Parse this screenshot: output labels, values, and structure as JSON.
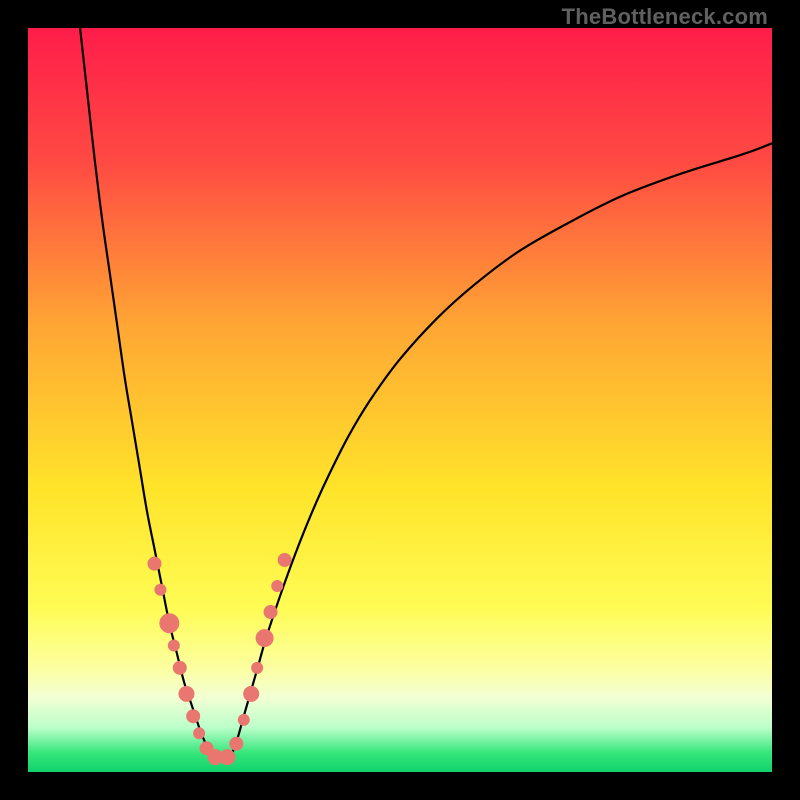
{
  "watermark": "TheBottleneck.com",
  "gradient": {
    "stops": [
      {
        "pct": 0,
        "color": "#ff1d4a"
      },
      {
        "pct": 18,
        "color": "#ff4a43"
      },
      {
        "pct": 40,
        "color": "#ffa634"
      },
      {
        "pct": 62,
        "color": "#ffe42a"
      },
      {
        "pct": 78,
        "color": "#fffc55"
      },
      {
        "pct": 86,
        "color": "#fcffa0"
      },
      {
        "pct": 90,
        "color": "#f2ffd4"
      },
      {
        "pct": 94,
        "color": "#bcffca"
      },
      {
        "pct": 97.5,
        "color": "#33e67a"
      },
      {
        "pct": 100,
        "color": "#11d26c"
      }
    ]
  },
  "chart_data": {
    "type": "line",
    "title": "",
    "xlabel": "",
    "ylabel": "",
    "xlim": [
      0,
      100
    ],
    "ylim": [
      0,
      100
    ],
    "note": "x/y are percentages of the plot area (0,0 = top-left). Two curves form a V-shaped bottleneck valley reaching the bottom near x≈25.",
    "series": [
      {
        "name": "left-curve",
        "x": [
          7,
          8,
          9,
          10,
          11,
          12,
          13,
          14,
          15,
          16,
          17,
          18,
          19,
          20,
          21,
          22,
          23,
          24,
          25
        ],
        "y": [
          0,
          9,
          18,
          26,
          33,
          40,
          47,
          53,
          59,
          65,
          70,
          75,
          80,
          84,
          88,
          91,
          94,
          96.5,
          98.5
        ]
      },
      {
        "name": "right-curve",
        "x": [
          27,
          28,
          29,
          30,
          31,
          32,
          34,
          36,
          38,
          40,
          43,
          46,
          50,
          55,
          60,
          66,
          73,
          80,
          88,
          96,
          100
        ],
        "y": [
          98.5,
          96,
          92.5,
          89,
          85.5,
          82,
          76,
          70.5,
          65.5,
          61,
          55,
          50,
          44.5,
          39,
          34.5,
          30,
          26,
          22.5,
          19.5,
          17,
          15.5
        ]
      }
    ],
    "markers": {
      "name": "scatter-points",
      "color": "#e9766f",
      "points": [
        {
          "x": 17.0,
          "y": 72.0,
          "r": 7
        },
        {
          "x": 17.8,
          "y": 75.5,
          "r": 6
        },
        {
          "x": 19.0,
          "y": 80.0,
          "r": 10
        },
        {
          "x": 19.6,
          "y": 83.0,
          "r": 6
        },
        {
          "x": 20.4,
          "y": 86.0,
          "r": 7
        },
        {
          "x": 21.3,
          "y": 89.5,
          "r": 8
        },
        {
          "x": 22.2,
          "y": 92.5,
          "r": 7
        },
        {
          "x": 23.0,
          "y": 94.8,
          "r": 6
        },
        {
          "x": 24.0,
          "y": 96.8,
          "r": 7
        },
        {
          "x": 25.2,
          "y": 98.0,
          "r": 8
        },
        {
          "x": 26.8,
          "y": 98.0,
          "r": 8
        },
        {
          "x": 28.0,
          "y": 96.2,
          "r": 7
        },
        {
          "x": 29.0,
          "y": 93.0,
          "r": 6
        },
        {
          "x": 30.0,
          "y": 89.5,
          "r": 8
        },
        {
          "x": 30.8,
          "y": 86.0,
          "r": 6
        },
        {
          "x": 31.8,
          "y": 82.0,
          "r": 9
        },
        {
          "x": 32.6,
          "y": 78.5,
          "r": 7
        },
        {
          "x": 33.5,
          "y": 75.0,
          "r": 6
        },
        {
          "x": 34.5,
          "y": 71.5,
          "r": 7
        }
      ]
    }
  }
}
